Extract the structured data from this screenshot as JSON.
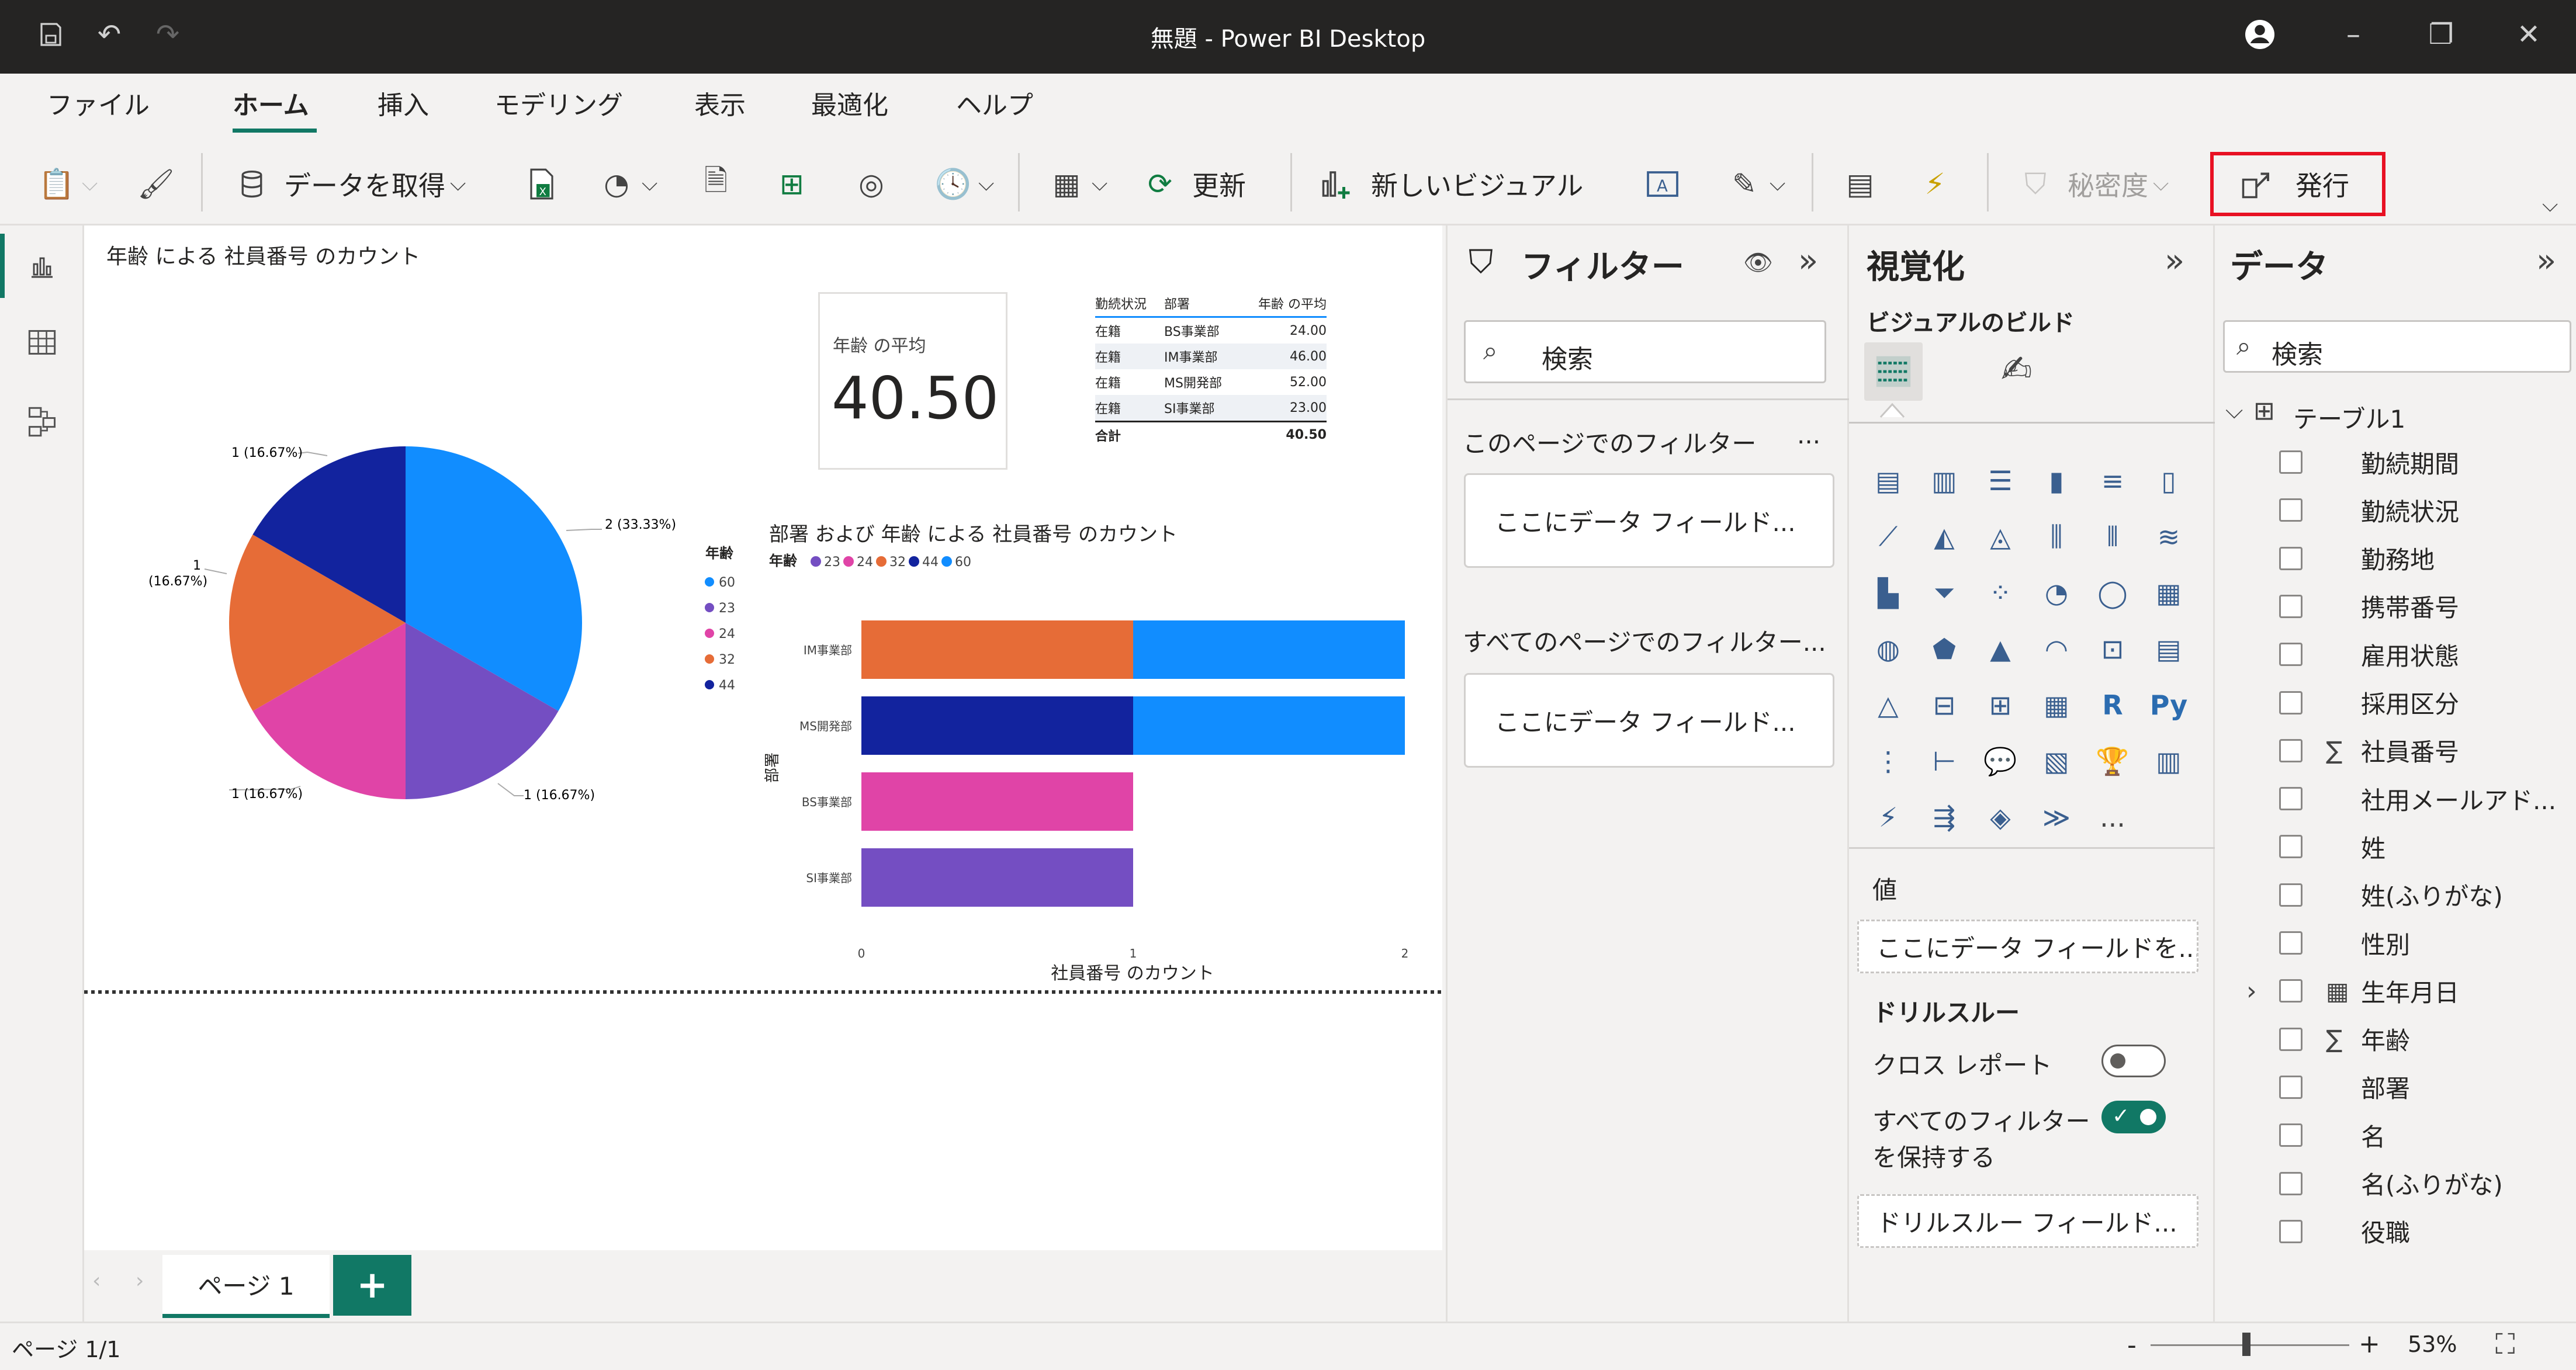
{
  "window": {
    "title": "無題 - Power BI Desktop"
  },
  "menu": {
    "tabs": [
      "ファイル",
      "ホーム",
      "挿入",
      "モデリング",
      "表示",
      "最適化",
      "ヘルプ"
    ]
  },
  "ribbon": {
    "get_data": "データを取得",
    "refresh": "更新",
    "new_visual": "新しいビジュアル",
    "sensitivity": "秘密度",
    "publish": "発行"
  },
  "canvas": {
    "pie": {
      "title": "年齢 による 社員番号 のカウント",
      "legend_title": "年齢",
      "labels": [
        "2 (33.33%)",
        "1 (16.67%)",
        "1 (16.67%)",
        "1",
        "(16.67%)",
        "1 (16.67%)"
      ]
    },
    "card": {
      "label": "年齢 の平均",
      "value": "40.50"
    },
    "table": {
      "headers": [
        "勤続状況",
        "部署",
        "年齢 の平均"
      ],
      "rows": [
        [
          "在籍",
          "BS事業部",
          "24.00"
        ],
        [
          "在籍",
          "IM事業部",
          "46.00"
        ],
        [
          "在籍",
          "MS開発部",
          "52.00"
        ],
        [
          "在籍",
          "SI事業部",
          "23.00"
        ]
      ],
      "total_label": "合計",
      "total_value": "40.50"
    },
    "bar": {
      "title": "部署 および 年齢 による 社員番号 のカウント",
      "legend_title": "年齢",
      "xlabel": "社員番号 のカウント",
      "ylabel": "部署"
    }
  },
  "chart_data": [
    {
      "type": "pie",
      "title": "年齢 による 社員番号 のカウント",
      "legend_title": "年齢",
      "categories": [
        "60",
        "23",
        "24",
        "32",
        "44"
      ],
      "values": [
        2,
        1,
        1,
        1,
        1
      ],
      "percent_labels": [
        "33.33%",
        "16.67%",
        "16.67%",
        "16.67%",
        "16.67%"
      ],
      "colors": [
        "#118dff",
        "#744ec2",
        "#e044a7",
        "#e66c37",
        "#12239e"
      ]
    },
    {
      "type": "bar",
      "orientation": "horizontal",
      "stacked": true,
      "title": "部署 および 年齢 による 社員番号 のカウント",
      "legend_title": "年齢",
      "categories": [
        "IM事業部",
        "MS開発部",
        "BS事業部",
        "SI事業部"
      ],
      "xlabel": "社員番号 のカウント",
      "ylabel": "部署",
      "xlim": [
        0,
        2
      ],
      "xticks": [
        "0",
        "1",
        "2"
      ],
      "series": [
        {
          "name": "23",
          "values": [
            0,
            0,
            0,
            1
          ],
          "color": "#744ec2"
        },
        {
          "name": "24",
          "values": [
            0,
            0,
            1,
            0
          ],
          "color": "#e044a7"
        },
        {
          "name": "32",
          "values": [
            1,
            0,
            0,
            0
          ],
          "color": "#e66c37"
        },
        {
          "name": "44",
          "values": [
            0,
            1,
            0,
            0
          ],
          "color": "#12239e"
        },
        {
          "name": "60",
          "values": [
            1,
            1,
            0,
            0
          ],
          "color": "#118dff"
        }
      ]
    }
  ],
  "filters": {
    "title": "フィルター",
    "search_placeholder": "検索",
    "page_filters": "このページでのフィルター",
    "page_more": "...",
    "all_pages": "すべてのページでのフィルター...",
    "drop_here": "ここにデータ フィールド..."
  },
  "viz": {
    "title": "視覚化",
    "build": "ビジュアルのビルド",
    "values_label": "値",
    "values_drop": "ここにデータ フィールドを...",
    "drill": "ドリルスルー",
    "cross_report": "クロス レポート",
    "keep_filters_1": "すべてのフィルター",
    "keep_filters_2": "を保持する",
    "drill_drop": "ドリルスルー フィールド...",
    "r_label": "R",
    "py_label": "Py",
    "more": "..."
  },
  "data": {
    "title": "データ",
    "search_placeholder": "検索",
    "table_name": "テーブル1",
    "fields": [
      "勤続期間",
      "勤続状況",
      "勤務地",
      "携帯番号",
      "雇用状態",
      "採用区分",
      "社員番号",
      "社用メールアド...",
      "姓",
      "姓(ふりがな)",
      "性別",
      "生年月日",
      "年齢",
      "部署",
      "名",
      "名(ふりがな)",
      "役職"
    ]
  },
  "pages": {
    "tab": "ページ 1",
    "add": "+"
  },
  "status": {
    "page": "ページ 1/1",
    "zoom": "53%",
    "minus": "-",
    "plus": "+"
  }
}
